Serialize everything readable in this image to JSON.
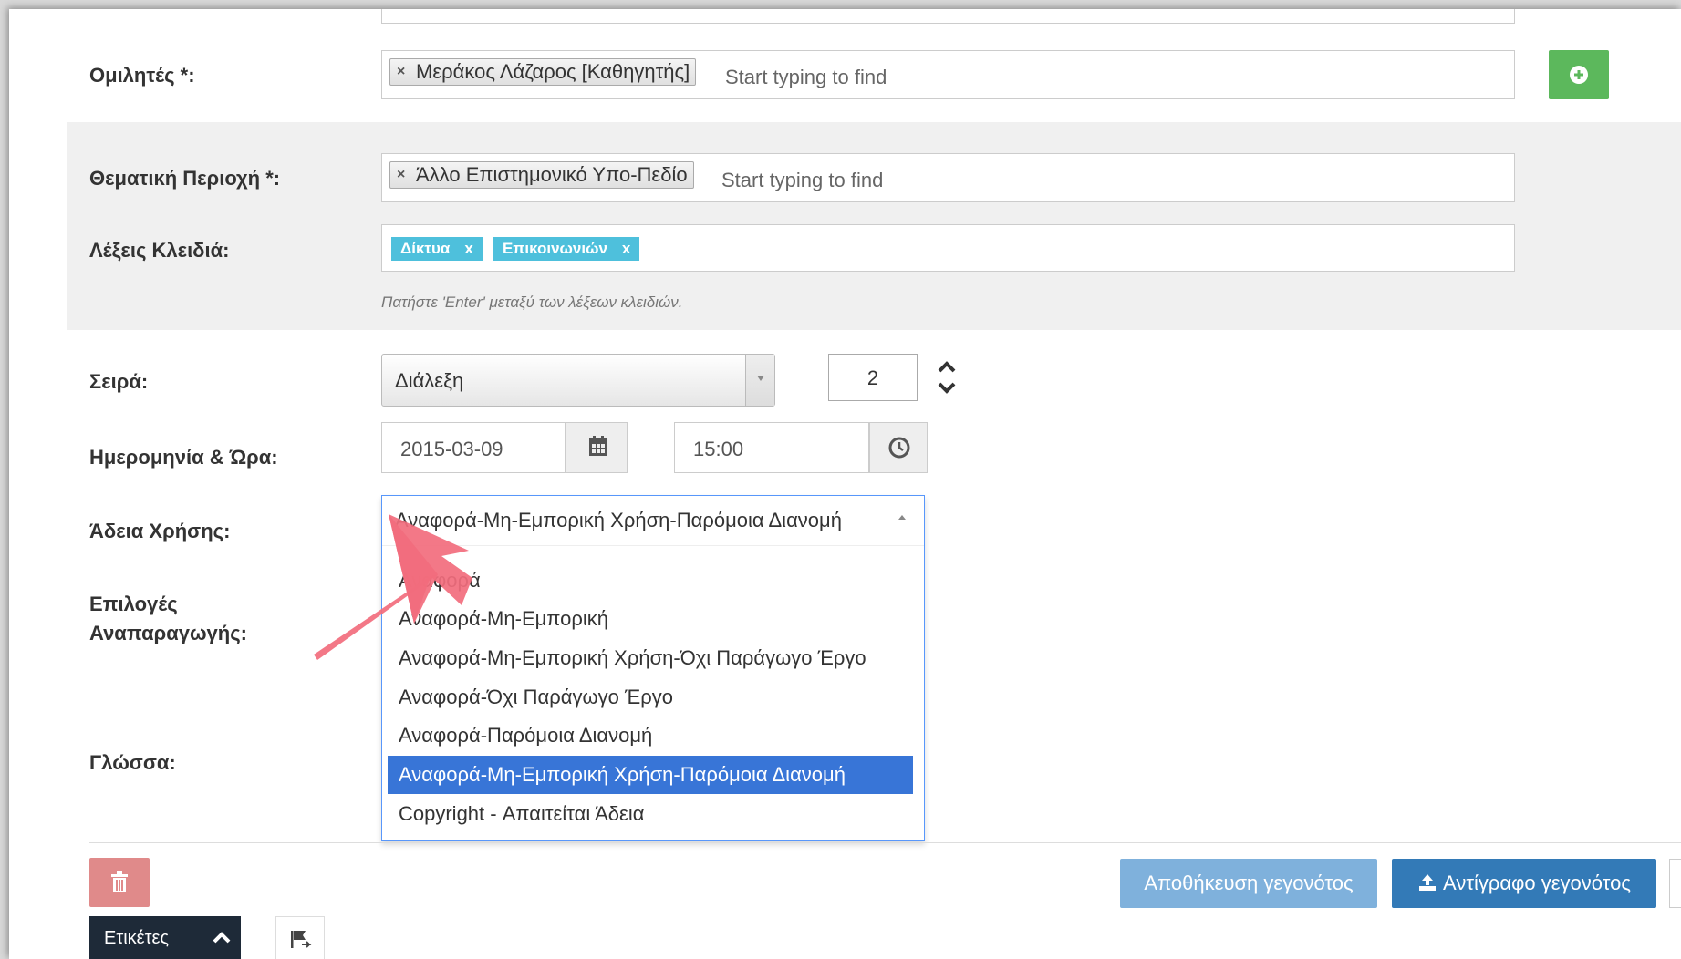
{
  "speakers": {
    "label": "Ομιλητές *:",
    "tag": "Μεράκος Λάζαρος [Καθηγητής]",
    "tag_remove": "×",
    "placeholder": "Start typing to find",
    "add_icon": "plus-circle-icon"
  },
  "subject_area": {
    "label": "Θεματική Περιοχή *:",
    "tag": "Άλλο Επιστημονικό Υπο-Πεδίο",
    "tag_remove": "×",
    "placeholder": "Start typing to find"
  },
  "keywords": {
    "label": "Λέξεις Κλειδιά:",
    "items": [
      {
        "text": "Δίκτυα",
        "remove": "x"
      },
      {
        "text": "Επικοινωνιών",
        "remove": "x"
      }
    ],
    "hint": "Πατήστε 'Enter' μεταξύ των λέξεων κλειδιών.",
    "color": "#4ec0dc"
  },
  "series": {
    "label": "Σειρά:",
    "value": "Διάλεξη",
    "number": "2"
  },
  "datetime": {
    "label": "Ημερομηνία & Ώρα:",
    "date": "2015-03-09",
    "time": "15:00",
    "calendar_icon": "calendar-icon",
    "clock_icon": "clock-icon"
  },
  "license": {
    "label": "Άδεια Χρήσης:",
    "selected": "Αναφορά-Μη-Εμπορική Χρήση-Παρόμοια Διανομή",
    "options": [
      "Αναφορά",
      "Αναφορά-Μη-Εμπορική",
      "Αναφορά-Μη-Εμπορική Χρήση-Όχι Παράγωγο Έργο",
      "Αναφορά-Όχι Παράγωγο Έργο",
      "Αναφορά-Παρόμοια Διανομή",
      "Αναφορά-Μη-Εμπορική Χρήση-Παρόμοια Διανομή",
      "Copyright - Απαιτείται Άδεια"
    ],
    "highlight_color": "#3875d7"
  },
  "reproduction": {
    "label_line1": "Επιλογές",
    "label_line2": "Αναπαραγωγής:"
  },
  "language": {
    "label": "Γλώσσα:"
  },
  "actions": {
    "delete_icon": "trash-icon",
    "save_label": "Αποθήκευση γεγονότος",
    "copy_label": "Αντίγραφο γεγονότος",
    "copy_icon": "copy-upload-icon",
    "save_color": "#7fb1dc",
    "copy_color": "#337ab7",
    "delete_color": "#e08a8a"
  },
  "footer": {
    "tags_label": "Ετικέτες",
    "flag_icon": "flag-icon"
  },
  "annotation": {
    "arrow_icon": "pointer-arrow-icon",
    "color": "#f26d7d"
  }
}
